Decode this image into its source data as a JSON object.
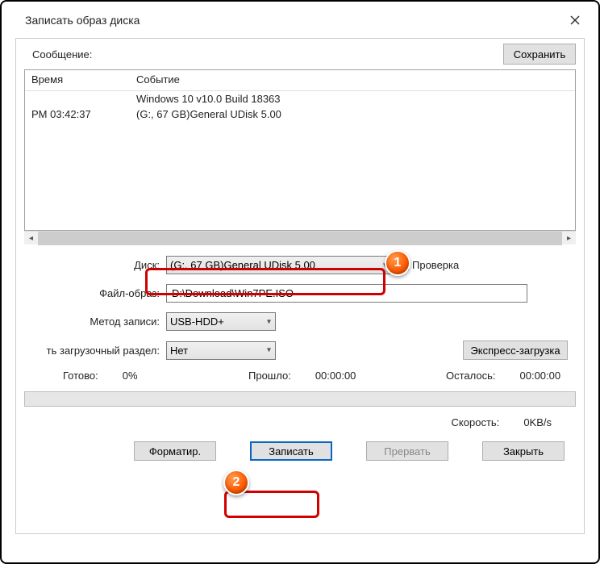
{
  "titlebar": {
    "title": "Записать образ диска"
  },
  "message": {
    "label": "Сообщение:",
    "save_btn": "Сохранить",
    "col_time": "Время",
    "col_event": "Событие",
    "rows": [
      {
        "time": "",
        "event": "Windows 10 v10.0 Build 18363"
      },
      {
        "time": "PM 03:42:37",
        "event": "(G:, 67 GB)General UDisk        5.00"
      }
    ]
  },
  "disk": {
    "label": "Диск:",
    "value": "(G:, 67 GB)General UDisk        5.00",
    "check_label": "Проверка"
  },
  "file_image": {
    "label": "Файл-образ:",
    "value": "D:\\Download\\Win7PE.ISO"
  },
  "method": {
    "label": "Метод записи:",
    "value": "USB-HDD+"
  },
  "boot": {
    "label": "ть загрузочный раздел:",
    "value": "Нет",
    "express_btn": "Экспресс-загрузка"
  },
  "status": {
    "ready_label": "Готово:",
    "ready_value": "0%",
    "elapsed_label": "Прошло:",
    "elapsed_value": "00:00:00",
    "remain_label": "Осталось:",
    "remain_value": "00:00:00"
  },
  "speed": {
    "label": "Скорость:",
    "value": "0KB/s"
  },
  "buttons": {
    "format": "Форматир.",
    "write": "Записать",
    "abort": "Прервать",
    "close": "Закрыть"
  },
  "badges": {
    "b1": "1",
    "b2": "2"
  }
}
